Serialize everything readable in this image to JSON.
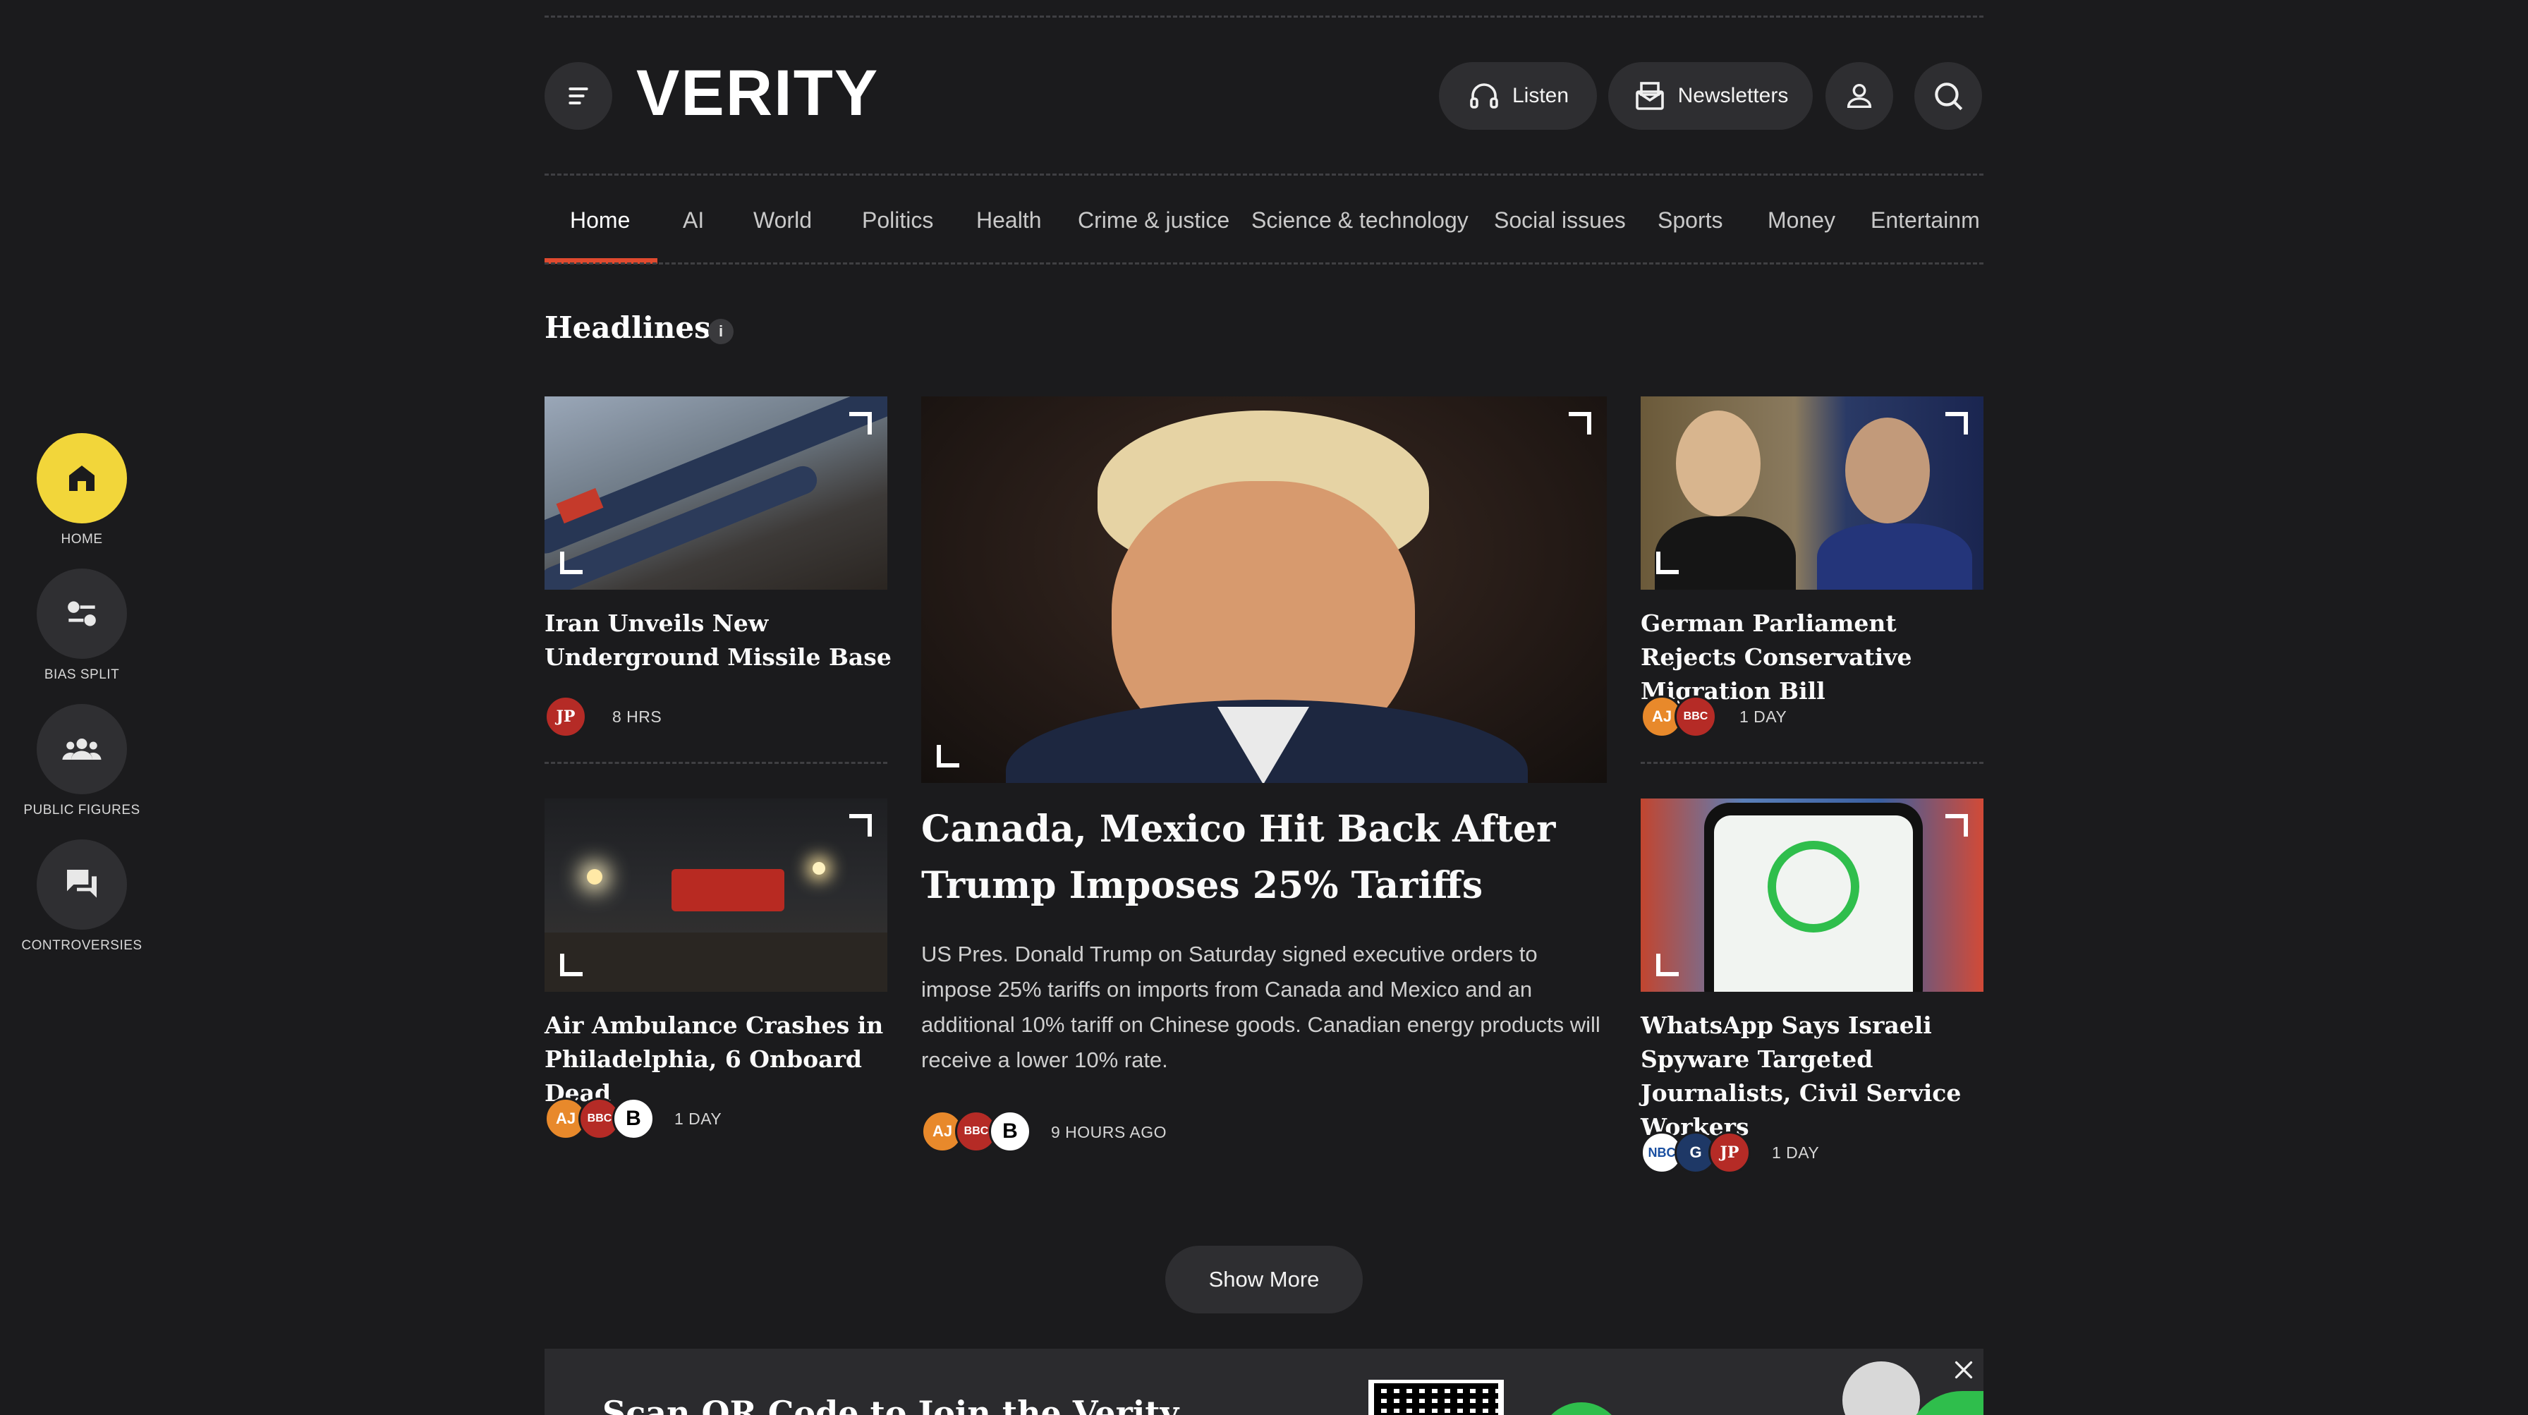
{
  "brand": {
    "logo": "VERITY"
  },
  "header": {
    "listen_label": "Listen",
    "newsletters_label": "Newsletters"
  },
  "nav": {
    "items": [
      "Home",
      "AI",
      "World",
      "Politics",
      "Health",
      "Crime & justice",
      "Science & technology",
      "Social issues",
      "Sports",
      "Money",
      "Entertainm"
    ]
  },
  "rail": {
    "items": [
      {
        "label": "HOME"
      },
      {
        "label": "BIAS SPLIT"
      },
      {
        "label": "PUBLIC FIGURES"
      },
      {
        "label": "CONTROVERSIES"
      }
    ]
  },
  "section": {
    "title": "Headlines",
    "info_icon": "i"
  },
  "stories": [
    {
      "title": "Iran Unveils New Underground Missile Base",
      "time": "8 HRS",
      "sources": [
        "JP"
      ]
    },
    {
      "title": "Canada, Mexico Hit Back After Trump Imposes 25% Tariffs",
      "summary": "US Pres. Donald Trump on Saturday signed executive orders to impose 25% tariffs on imports from Canada and Mexico and an additional 10% tariff on Chinese goods. Canadian energy products will receive a lower 10% rate.",
      "time": "9 HOURS AGO",
      "sources": [
        "AJ",
        "BBC",
        "B"
      ]
    },
    {
      "title": "German Parliament Rejects Conservative Migration Bill",
      "time": "1 DAY",
      "sources": [
        "AJ",
        "BBC"
      ]
    },
    {
      "title": "Air Ambulance Crashes in Philadelphia, 6 Onboard Dead",
      "time": "1 DAY",
      "sources": [
        "AJ",
        "BBC",
        "B"
      ]
    },
    {
      "title": "WhatsApp Says Israeli Spyware Targeted Journalists, Civil Service Workers",
      "time": "1 DAY",
      "sources": [
        "NBC",
        "G",
        "JP"
      ]
    }
  ],
  "show_more_label": "Show More",
  "banner": {
    "title_partial": "Scan QR Code to Join the Verity"
  },
  "colors": {
    "accent": "#e04a2f",
    "home_active": "#f2d63a",
    "background": "#1b1b1d"
  }
}
